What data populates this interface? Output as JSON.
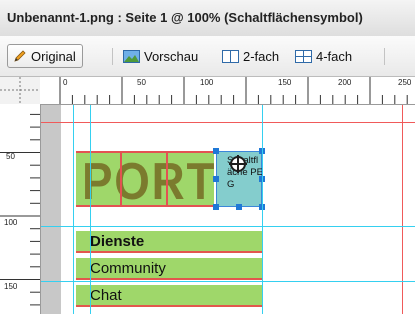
{
  "window": {
    "title": "Unbenannt-1.png : Seite 1 @ 100% (Schaltflächensymbol)"
  },
  "tabs": [
    {
      "label": "Original",
      "icon": "pencil-icon",
      "active": true
    },
    {
      "label": "Vorschau",
      "icon": "preview-icon",
      "active": false
    },
    {
      "label": "2-fach",
      "icon": "two-up-icon",
      "active": false
    },
    {
      "label": "4-fach",
      "icon": "four-up-icon",
      "active": false
    }
  ],
  "ruler": {
    "horizontal": [
      "0",
      "50",
      "100",
      "150",
      "200",
      "250"
    ],
    "vertical": [
      "50",
      "100",
      "150"
    ]
  },
  "canvas": {
    "banner_text": "PORTA",
    "selected_slice": {
      "label": "Schaltfläche PEG"
    },
    "menu_items": [
      "Dienste",
      "Community",
      "Chat"
    ]
  },
  "colors": {
    "slice_fill": "#9fd76a",
    "slice_border": "#e2574d",
    "selection_fill": "#6ec4c4",
    "selection_handle": "#1f78d6",
    "guide": "#35d0f0"
  }
}
